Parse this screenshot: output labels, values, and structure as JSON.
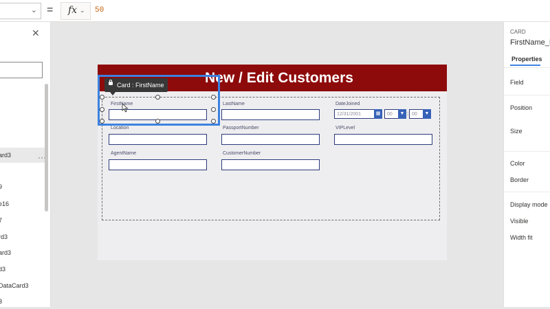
{
  "formula_bar": {
    "property": "",
    "equals": "=",
    "fx_label": "fx",
    "value": "50"
  },
  "tree": {
    "items": [
      {
        "label": "ard3"
      },
      {
        "label": "9"
      },
      {
        "label": "e16"
      },
      {
        "label": "7"
      },
      {
        "label": "rd3"
      },
      {
        "label": "ard3"
      },
      {
        "label": "d3"
      },
      {
        "label": "DataCard3"
      },
      {
        "label": "3"
      }
    ],
    "more": "···"
  },
  "form": {
    "title": "New / Edit Customers",
    "fields": {
      "first_name": "FirstName",
      "last_name": "LastName",
      "date_joined": "DateJoined",
      "location": "Location",
      "passport_number": "PassportNumber",
      "vip_level": "VIPLevel",
      "agent_name": "AgentName",
      "customer_number": "CustomerNumber"
    },
    "date_value": "12/31/2001",
    "hour_value": "00",
    "minute_value": "00",
    "colon": ":"
  },
  "selection": {
    "tooltip": "Card : FirstName"
  },
  "right_panel": {
    "type": "CARD",
    "name": "FirstName_D",
    "tab": "Properties",
    "props": [
      "Field",
      "Position",
      "Size",
      "Color",
      "Border",
      "Display mode",
      "Visible",
      "Width fit"
    ]
  },
  "colors": {
    "title_bar": "#8e0b0b",
    "selection": "#3b82e0",
    "input_border": "#2b3a7a",
    "formula_value": "#c25f0b"
  }
}
